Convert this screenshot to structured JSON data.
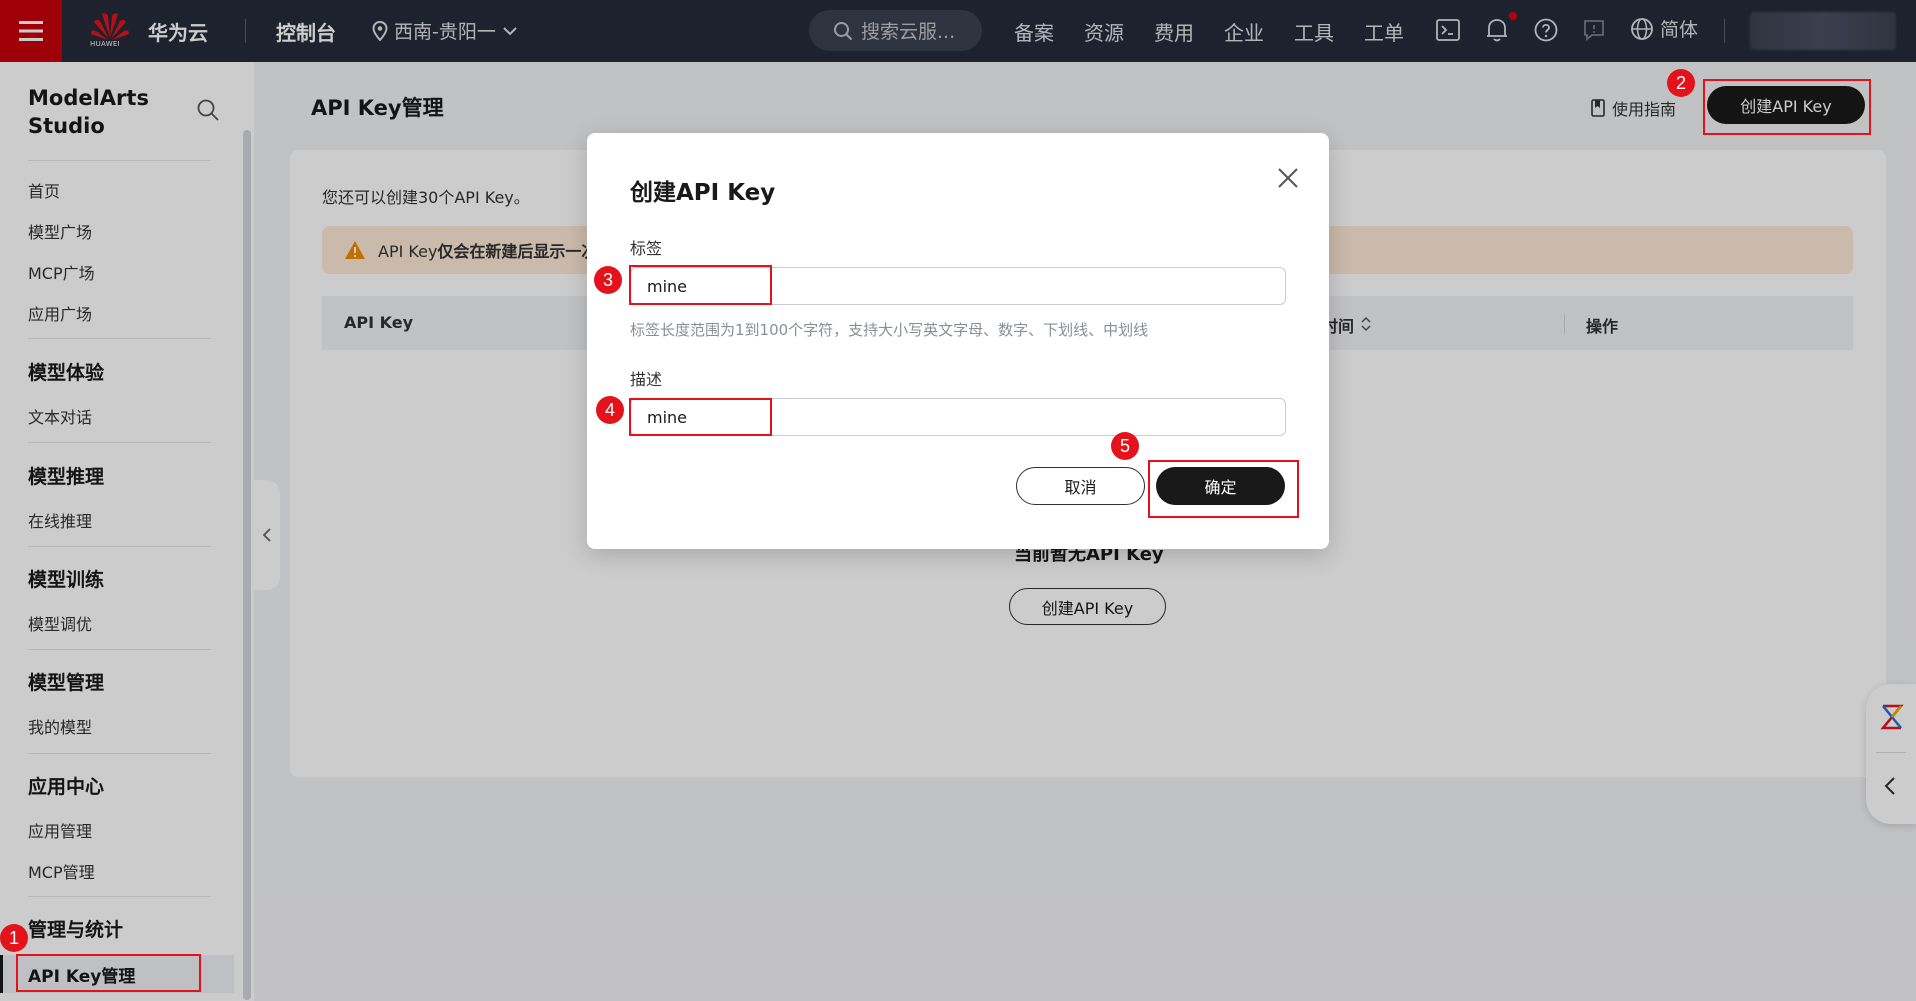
{
  "topbar": {
    "logo_text": "HUAWEI",
    "brand": "华为云",
    "console": "控制台",
    "region": "西南-贵阳一",
    "search_placeholder": "搜索云服...",
    "nav": [
      "备案",
      "资源",
      "费用",
      "企业",
      "工具",
      "工单"
    ],
    "language": "简体",
    "icons": [
      "menu-icon",
      "location-icon",
      "chevron-down-icon",
      "search-icon",
      "terminal-icon",
      "bell-icon",
      "help-icon",
      "feedback-icon",
      "globe-icon"
    ]
  },
  "sidebar": {
    "title": "ModelArts Studio",
    "top_items": [
      "首页",
      "模型广场",
      "MCP广场",
      "应用广场"
    ],
    "groups": [
      {
        "title": "模型体验",
        "items": [
          "文本对话"
        ]
      },
      {
        "title": "模型推理",
        "items": [
          "在线推理"
        ]
      },
      {
        "title": "模型训练",
        "items": [
          "模型调优"
        ]
      },
      {
        "title": "模型管理",
        "items": [
          "我的模型"
        ]
      },
      {
        "title": "应用中心",
        "items": [
          "应用管理",
          "MCP管理"
        ]
      },
      {
        "title": "管理与统计",
        "items": []
      }
    ],
    "active_item": "API Key管理"
  },
  "main": {
    "title": "API Key管理",
    "guide_label": "使用指南",
    "create_button": "创建API Key",
    "quota_text": "您还可以创建30个API Key。",
    "warning_prefix": "API Key",
    "warning_bold": "仅会在新建后显示一次",
    "table_headers": [
      "API Key",
      "时间",
      "操作"
    ],
    "empty_text": "当前暂无API Key",
    "empty_button": "创建API Key"
  },
  "modal": {
    "title": "创建API Key",
    "tag_label": "标签",
    "tag_value": "mine",
    "tag_help": "标签长度范围为1到100个字符，支持大小写英文字母、数字、下划线、中划线",
    "desc_label": "描述",
    "desc_value": "mine",
    "cancel": "取消",
    "confirm": "确定"
  },
  "annotations": {
    "steps": [
      "1",
      "2",
      "3",
      "4",
      "5"
    ],
    "color": "#e4131b"
  },
  "colors": {
    "topbar_bg": "#252b3a",
    "brand_red": "#c7000b",
    "primary_button": "#191919",
    "warning_bg": "#fde9d6",
    "warning_icon": "#f28c00"
  }
}
